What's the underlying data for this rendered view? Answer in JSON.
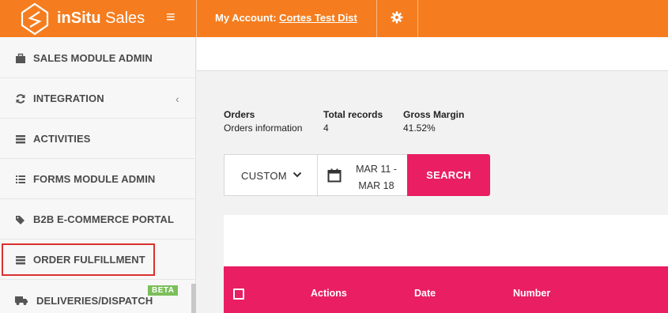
{
  "topbar": {
    "brand_bold": "inSitu",
    "brand_light": " Sales",
    "account_prefix": "My Account: ",
    "account_name": "Cortes Test Dist"
  },
  "sidebar": {
    "items": [
      {
        "label": "SALES MODULE ADMIN",
        "icon": "briefcase-icon"
      },
      {
        "label": "INTEGRATION",
        "icon": "refresh-icon"
      },
      {
        "label": "ACTIVITIES",
        "icon": "list-icon"
      },
      {
        "label": "FORMS MODULE ADMIN",
        "icon": "bullet-list-icon"
      },
      {
        "label": "B2B E-COMMERCE PORTAL",
        "icon": "tags-icon"
      },
      {
        "label": "ORDER FULFILLMENT",
        "icon": "list-icon"
      },
      {
        "label": "DELIVERIES/DISPATCH",
        "icon": "truck-icon",
        "badge": "BETA"
      }
    ]
  },
  "summary": {
    "orders_title": "Orders",
    "orders_sub": "Orders information",
    "total_title": "Total records",
    "total_value": "4",
    "margin_title": "Gross Margin",
    "margin_value": "41.52%"
  },
  "filter": {
    "range_type": "CUSTOM",
    "date_line1": "MAR 11 -",
    "date_line2": "MAR 18",
    "search_label": "SEARCH"
  },
  "table": {
    "columns": [
      "Actions",
      "Date",
      "Number"
    ]
  },
  "colors": {
    "brand_orange": "#f57d1f",
    "accent_pink": "#e91e63",
    "highlight_red": "#d9302f",
    "beta_green": "#7bbf5a"
  }
}
